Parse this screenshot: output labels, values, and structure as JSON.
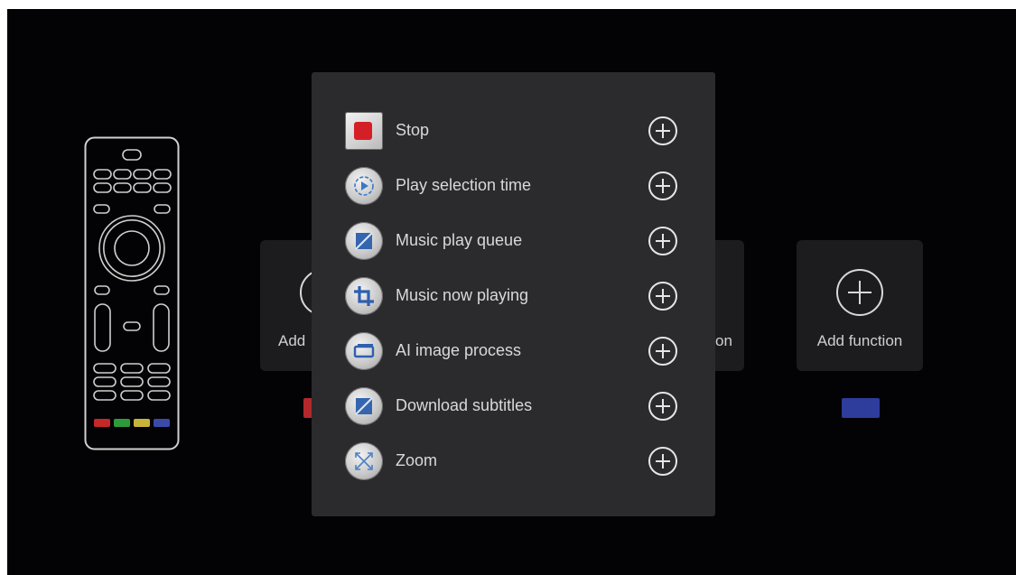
{
  "cards": {
    "left_partial_label": "Add",
    "mid_partial_label": "on",
    "right_label": "Add function"
  },
  "colors": {
    "screen_bg": "#030305",
    "popup_bg": "#2b2b2e",
    "swatch_red": "#b2282b",
    "swatch_blue": "#2e3c9c",
    "key_red": "#c62828",
    "key_green": "#2e9b3a",
    "key_yellow": "#c9b43a",
    "key_blue": "#3b4aa8"
  },
  "popup": {
    "items": [
      {
        "label": "Stop",
        "icon": "stop-icon"
      },
      {
        "label": "Play selection time",
        "icon": "play-time-icon"
      },
      {
        "label": "Music play queue",
        "icon": "music-queue-icon"
      },
      {
        "label": "Music now playing",
        "icon": "crop-icon"
      },
      {
        "label": "AI image process",
        "icon": "ai-image-icon"
      },
      {
        "label": "Download subtitles",
        "icon": "subtitles-icon"
      },
      {
        "label": "Zoom",
        "icon": "zoom-icon"
      }
    ]
  }
}
